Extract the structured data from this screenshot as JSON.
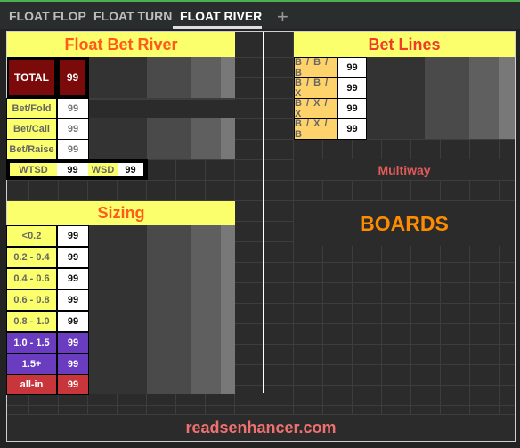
{
  "tabs": [
    {
      "label": "FLOAT FLOP"
    },
    {
      "label": "FLOAT TURN"
    },
    {
      "label": "FLOAT RIVER",
      "active": true
    }
  ],
  "add_tab_icon": "plus-icon",
  "float_bet_river": {
    "title": "Float Bet River",
    "total_label": "TOTAL",
    "total_value": "99",
    "rows": [
      {
        "label": "Bet/Fold",
        "value": "99"
      },
      {
        "label": "Bet/Call",
        "value": "99"
      },
      {
        "label": "Bet/Raise",
        "value": "99"
      }
    ],
    "wtsd_label": "WTSD",
    "wtsd_value": "99",
    "wsd_label": "WSD",
    "wsd_value": "99"
  },
  "sizing": {
    "title": "Sizing",
    "rows": [
      {
        "label": "<0.2",
        "value": "99"
      },
      {
        "label": "0.2 - 0.4",
        "value": "99"
      },
      {
        "label": "0.4 - 0.6",
        "value": "99"
      },
      {
        "label": "0.6 - 0.8",
        "value": "99"
      },
      {
        "label": "0.8 - 1.0",
        "value": "99"
      },
      {
        "label": "1.0 - 1.5",
        "value": "99"
      },
      {
        "label": "1.5+",
        "value": "99"
      },
      {
        "label": "all-in",
        "value": "99"
      }
    ]
  },
  "bet_lines": {
    "title": "Bet Lines",
    "rows": [
      {
        "label": "B / B / B",
        "value": "99"
      },
      {
        "label": "B / B / X",
        "value": "99"
      },
      {
        "label": "B / X / X",
        "value": "99"
      },
      {
        "label": "B / X / B",
        "value": "99"
      }
    ]
  },
  "multiway": "Multiway",
  "boards": "BOARDS",
  "footer": "readsenhancer.com",
  "colors": {
    "accent_green": "#4caf50",
    "header_yellow": "#fbff6b",
    "title_orange": "#ff5a1a",
    "total_red": "#7b0a0a",
    "purple": "#6a3cc0",
    "allin_red": "#c8363b",
    "bet_line_orange": "#ffd36b",
    "boards_orange": "#ff8c00"
  }
}
